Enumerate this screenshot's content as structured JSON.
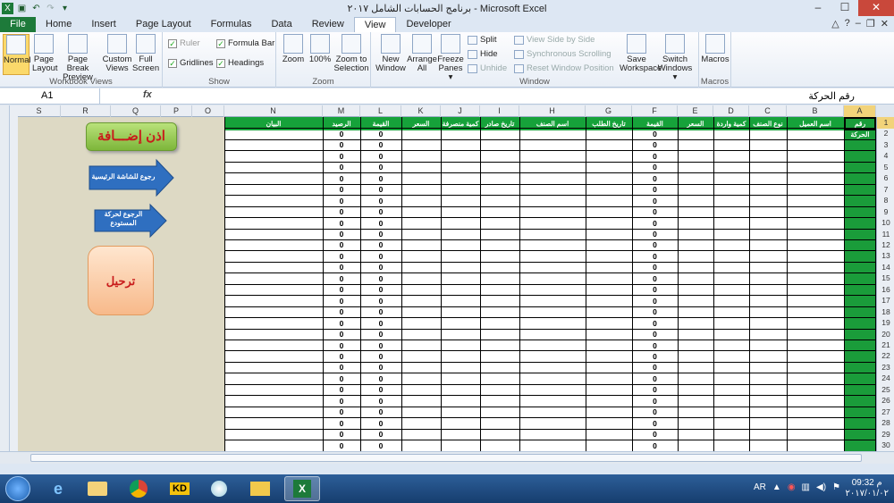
{
  "window": {
    "title": "برنامج الحسابات الشامل ٢٠١٧ - Microsoft Excel",
    "controls": [
      "–",
      "☐",
      "✕"
    ]
  },
  "ribbon_tabs": [
    "File",
    "Home",
    "Insert",
    "Page Layout",
    "Formulas",
    "Data",
    "Review",
    "View",
    "Developer"
  ],
  "active_tab": "View",
  "ribbon": {
    "workbook_views": {
      "label": "Workbook Views",
      "buttons": [
        "Normal",
        "Page Layout",
        "Page Break Preview",
        "Custom Views",
        "Full Screen"
      ]
    },
    "show": {
      "label": "Show",
      "ruler": "Ruler",
      "formula_bar": "Formula Bar",
      "gridlines": "Gridlines",
      "headings": "Headings"
    },
    "zoom": {
      "label": "Zoom",
      "buttons": [
        "Zoom",
        "100%",
        "Zoom to Selection"
      ]
    },
    "window": {
      "label": "Window",
      "buttons": [
        "New Window",
        "Arrange All",
        "Freeze Panes ▾"
      ],
      "split": "Split",
      "hide": "Hide",
      "unhide": "Unhide",
      "side_by_side": "View Side by Side",
      "sync_scroll": "Synchronous Scrolling",
      "reset_pos": "Reset Window Position",
      "save_ws": "Save Workspace",
      "switch": "Switch Windows ▾"
    },
    "macros": {
      "label": "Macros",
      "button": "Macros"
    }
  },
  "formula_bar": {
    "name_box": "A1",
    "fx": "fx",
    "content": "رقم الحركة"
  },
  "column_letters": [
    "S",
    "R",
    "Q",
    "P",
    "O",
    "N",
    "M",
    "L",
    "K",
    "J",
    "I",
    "H",
    "G",
    "F",
    "E",
    "D",
    "C",
    "B",
    "A"
  ],
  "row_numbers": [
    "1",
    "2",
    "3",
    "4",
    "5",
    "6",
    "7",
    "8",
    "9",
    "10",
    "11",
    "12",
    "13",
    "14",
    "15",
    "16",
    "17",
    "18",
    "19",
    "20",
    "21",
    "22",
    "23",
    "24",
    "25",
    "26",
    "27",
    "28",
    "29",
    "30"
  ],
  "sheet_headers": {
    "A": "رقم الحركة",
    "B": "اسم العميل",
    "C": "نوع الصنف",
    "D": "كمية واردة",
    "E": "السعر",
    "F": "القيمة",
    "G": "تاريخ الطلب",
    "H": "اسم الصنف",
    "I": "تاريخ صادر",
    "J": "كمية منصرفة",
    "K": "السعر",
    "L": "القيمة",
    "M": "الرصيد",
    "N": "البيان"
  },
  "zero_value": "0",
  "shapes": {
    "add_permission": "اذن إضـــافة",
    "back_main": "رجوع للشاشة الرئيسية",
    "back_warehouse": "الرجوع لحركة المستودع",
    "transfer": "ترحيل"
  },
  "taskbar": {
    "apps": [
      "IE",
      "Explorer",
      "Chrome",
      "KD",
      "Paint",
      "Folder",
      "Excel"
    ],
    "lang": "AR",
    "time": "09:32 م",
    "date": "٢٠١٧/٠١/٠٢"
  }
}
